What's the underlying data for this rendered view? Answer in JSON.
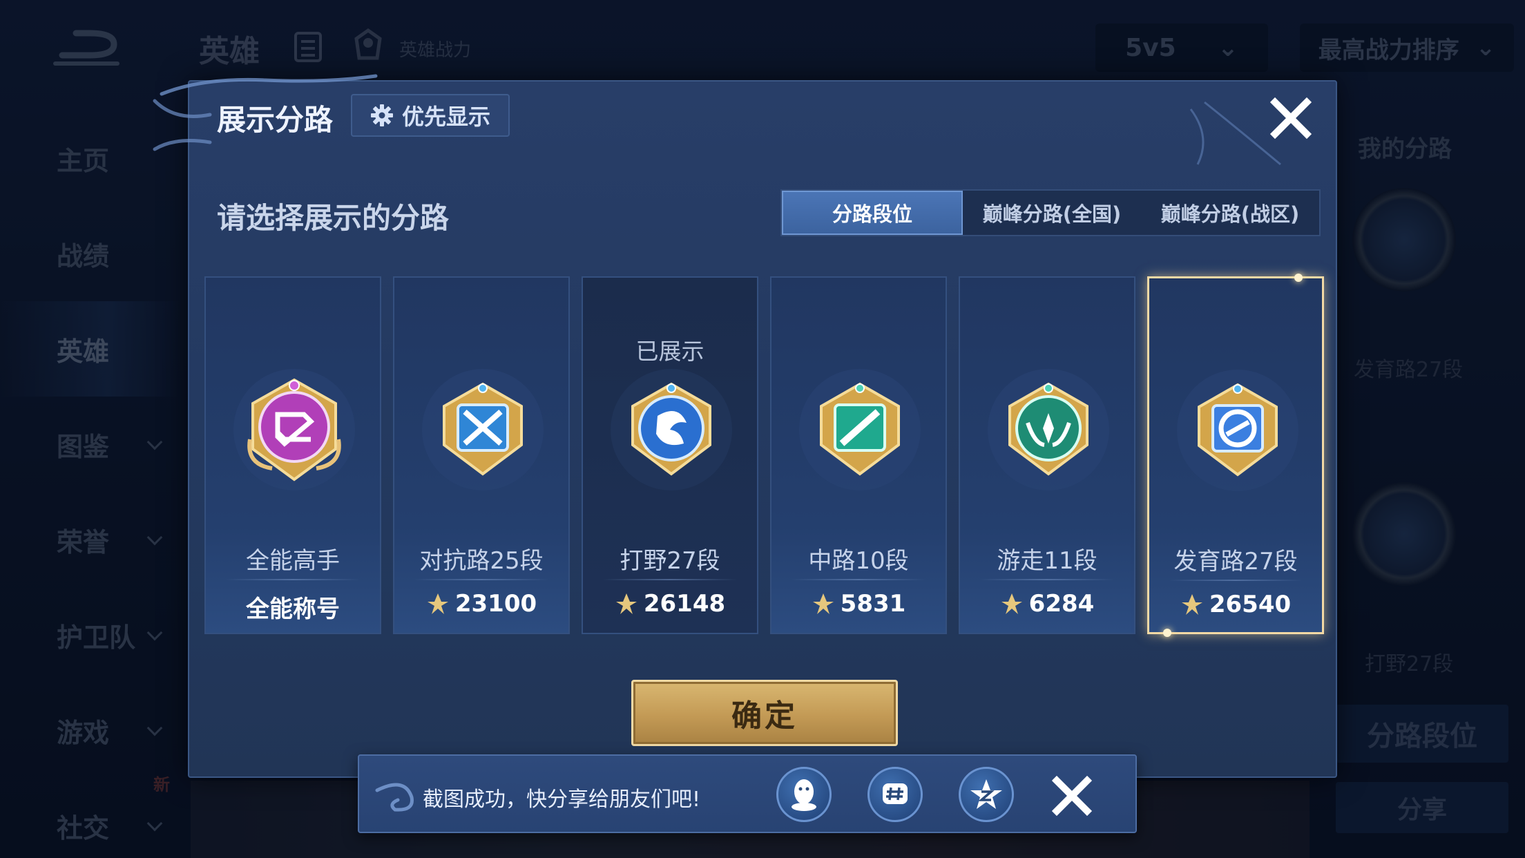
{
  "background": {
    "top_title": "英雄",
    "top_power_label": "英雄战力",
    "mode_select": "5v5",
    "sort_select": "最高战力排序",
    "nav": [
      {
        "label": "主页"
      },
      {
        "label": "战绩"
      },
      {
        "label": "英雄"
      },
      {
        "label": "图鉴"
      },
      {
        "label": "荣誉"
      },
      {
        "label": "护卫队"
      },
      {
        "label": "游戏"
      },
      {
        "label": "社交",
        "badge": "新"
      }
    ],
    "right_panel": {
      "title": "我的分路",
      "label1": "发育路27段",
      "label2": "打野27段",
      "button1": "分路段位",
      "button2": "分享"
    }
  },
  "modal": {
    "title": "展示分路",
    "priority_label": "优先显示",
    "subtitle": "请选择展示的分路",
    "tabs": [
      {
        "label": "分路段位",
        "active": true
      },
      {
        "label": "巅峰分路(全国)",
        "active": false
      },
      {
        "label": "巅峰分路(战区)",
        "active": false
      }
    ],
    "cards": [
      {
        "name": "全能高手",
        "score": "全能称号",
        "shown": "",
        "color": "#b13fb8"
      },
      {
        "name": "对抗路25段",
        "score": "23100",
        "shown": "",
        "color": "#2f86d6"
      },
      {
        "name": "打野27段",
        "score": "26148",
        "shown": "已展示",
        "color": "#2a6fd0"
      },
      {
        "name": "中路10段",
        "score": "5831",
        "shown": "",
        "color": "#1fa98e"
      },
      {
        "name": "游走11段",
        "score": "6284",
        "shown": "",
        "color": "#1e8c74"
      },
      {
        "name": "发育路27段",
        "score": "26540",
        "shown": "",
        "color": "#3b7fe0"
      }
    ],
    "confirm_label": "确定"
  },
  "toast": {
    "text": "截图成功，快分享给朋友们吧!",
    "share_targets": [
      "qq-icon",
      "wechat-moments-icon",
      "qzone-icon"
    ]
  },
  "colors": {
    "gold": "#f2d9a5",
    "tab_active": "#4b75b6"
  }
}
